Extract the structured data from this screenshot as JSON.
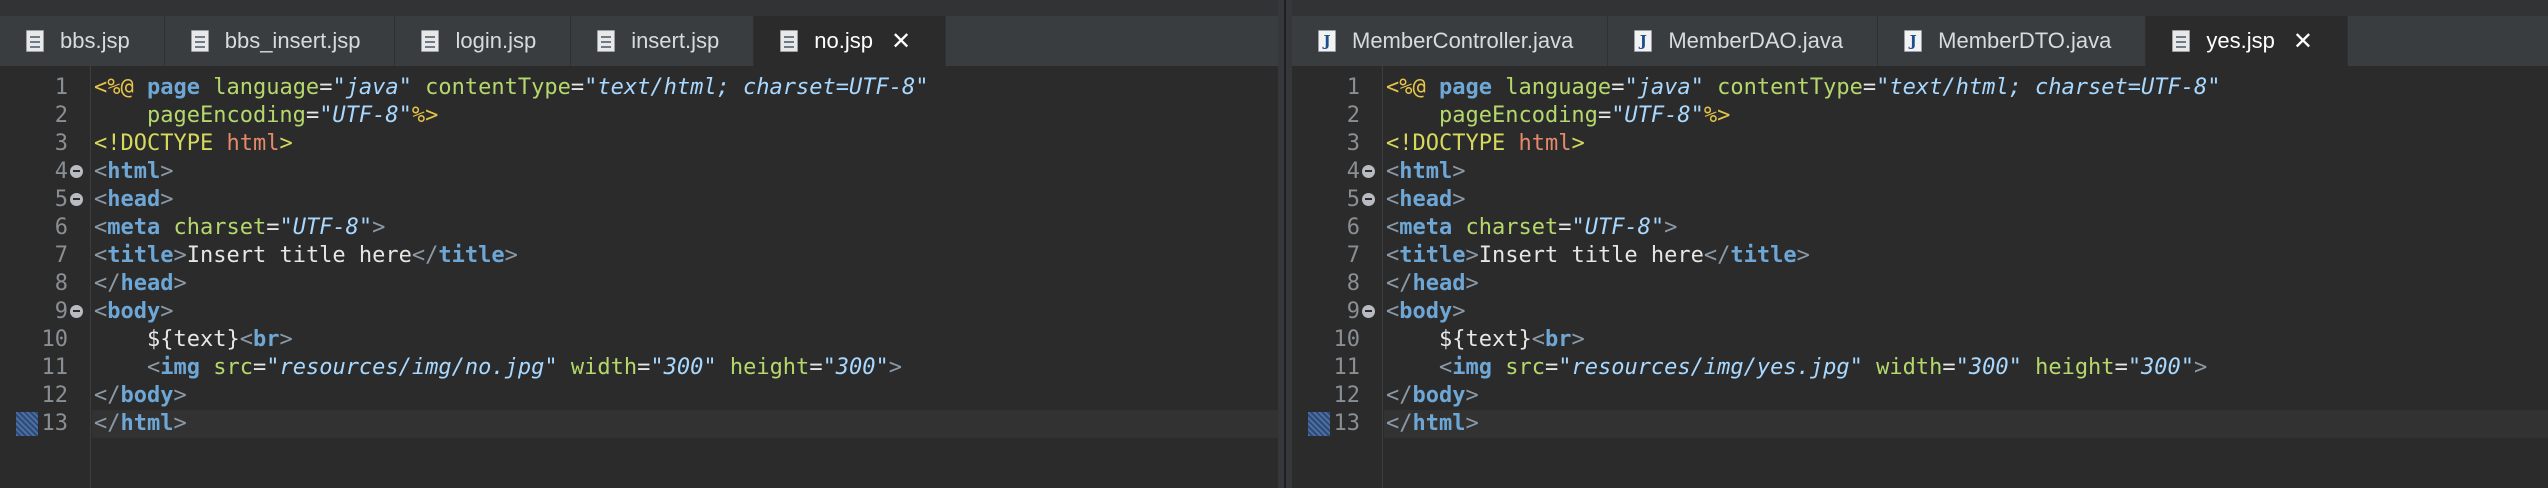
{
  "left_pane": {
    "tabs": [
      {
        "label": "bbs.jsp",
        "icon": "jsp-file-icon",
        "active": false
      },
      {
        "label": "bbs_insert.jsp",
        "icon": "jsp-file-icon",
        "active": false
      },
      {
        "label": "login.jsp",
        "icon": "jsp-file-icon",
        "active": false
      },
      {
        "label": "insert.jsp",
        "icon": "jsp-file-icon",
        "active": false
      },
      {
        "label": "no.jsp",
        "icon": "jsp-file-icon",
        "active": true,
        "close": "✕"
      }
    ],
    "lines": [
      {
        "n": "1",
        "tokens": [
          [
            "dir",
            "<%@ "
          ],
          [
            "kw",
            "page "
          ],
          [
            "attr",
            "language"
          ],
          [
            "text",
            "="
          ],
          [
            "str",
            "\"java\" "
          ],
          [
            "attr",
            "contentType"
          ],
          [
            "text",
            "="
          ],
          [
            "str",
            "\"text/html; charset=UTF-8\""
          ]
        ]
      },
      {
        "n": "2",
        "tokens": [
          [
            "text",
            "    "
          ],
          [
            "attr",
            "pageEncoding"
          ],
          [
            "text",
            "="
          ],
          [
            "str",
            "\"UTF-8\""
          ],
          [
            "dir",
            "%>"
          ]
        ]
      },
      {
        "n": "3",
        "tokens": [
          [
            "doc",
            "<!DOCTYPE "
          ],
          [
            "html",
            "html"
          ],
          [
            "doc",
            ">"
          ]
        ]
      },
      {
        "n": "4",
        "fold": true,
        "tokens": [
          [
            "br",
            "<"
          ],
          [
            "kw",
            "html"
          ],
          [
            "br",
            ">"
          ]
        ]
      },
      {
        "n": "5",
        "fold": true,
        "tokens": [
          [
            "br",
            "<"
          ],
          [
            "kw",
            "head"
          ],
          [
            "br",
            ">"
          ]
        ]
      },
      {
        "n": "6",
        "tokens": [
          [
            "br",
            "<"
          ],
          [
            "kw",
            "meta "
          ],
          [
            "attr",
            "charset"
          ],
          [
            "text",
            "="
          ],
          [
            "str",
            "\"UTF-8\""
          ],
          [
            "br",
            ">"
          ]
        ]
      },
      {
        "n": "7",
        "tokens": [
          [
            "br",
            "<"
          ],
          [
            "kw",
            "title"
          ],
          [
            "br",
            ">"
          ],
          [
            "text",
            "Insert title here"
          ],
          [
            "br",
            "</"
          ],
          [
            "kw",
            "title"
          ],
          [
            "br",
            ">"
          ]
        ]
      },
      {
        "n": "8",
        "tokens": [
          [
            "br",
            "</"
          ],
          [
            "kw",
            "head"
          ],
          [
            "br",
            ">"
          ]
        ]
      },
      {
        "n": "9",
        "fold": true,
        "tokens": [
          [
            "br",
            "<"
          ],
          [
            "kw",
            "body"
          ],
          [
            "br",
            ">"
          ]
        ]
      },
      {
        "n": "10",
        "tokens": [
          [
            "text",
            "    ${text}"
          ],
          [
            "br",
            "<"
          ],
          [
            "kw",
            "br"
          ],
          [
            "br",
            ">"
          ]
        ]
      },
      {
        "n": "11",
        "tokens": [
          [
            "text",
            "    "
          ],
          [
            "br",
            "<"
          ],
          [
            "kw",
            "img "
          ],
          [
            "attr",
            "src"
          ],
          [
            "text",
            "="
          ],
          [
            "str",
            "\"resources/img/no.jpg\" "
          ],
          [
            "attr",
            "width"
          ],
          [
            "text",
            "="
          ],
          [
            "str",
            "\"300\" "
          ],
          [
            "attr",
            "height"
          ],
          [
            "text",
            "="
          ],
          [
            "str",
            "\"300\""
          ],
          [
            "br",
            ">"
          ]
        ]
      },
      {
        "n": "12",
        "tokens": [
          [
            "br",
            "</"
          ],
          [
            "kw",
            "body"
          ],
          [
            "br",
            ">"
          ]
        ]
      },
      {
        "n": "13",
        "current": true,
        "marker": true,
        "tokens": [
          [
            "br",
            "</"
          ],
          [
            "kw",
            "html"
          ],
          [
            "br",
            ">"
          ]
        ]
      }
    ]
  },
  "right_pane": {
    "tabs": [
      {
        "label": "MemberController.java",
        "icon": "java-file-icon",
        "active": false
      },
      {
        "label": "MemberDAO.java",
        "icon": "java-file-icon",
        "active": false
      },
      {
        "label": "MemberDTO.java",
        "icon": "java-file-icon",
        "active": false
      },
      {
        "label": "yes.jsp",
        "icon": "jsp-file-icon",
        "active": true,
        "close": "✕"
      }
    ],
    "lines": [
      {
        "n": "1",
        "tokens": [
          [
            "dir",
            "<%@ "
          ],
          [
            "kw",
            "page "
          ],
          [
            "attr",
            "language"
          ],
          [
            "text",
            "="
          ],
          [
            "str",
            "\"java\" "
          ],
          [
            "attr",
            "contentType"
          ],
          [
            "text",
            "="
          ],
          [
            "str",
            "\"text/html; charset=UTF-8\""
          ]
        ]
      },
      {
        "n": "2",
        "tokens": [
          [
            "text",
            "    "
          ],
          [
            "attr",
            "pageEncoding"
          ],
          [
            "text",
            "="
          ],
          [
            "str",
            "\"UTF-8\""
          ],
          [
            "dir",
            "%>"
          ]
        ]
      },
      {
        "n": "3",
        "tokens": [
          [
            "doc",
            "<!DOCTYPE "
          ],
          [
            "html",
            "html"
          ],
          [
            "doc",
            ">"
          ]
        ]
      },
      {
        "n": "4",
        "fold": true,
        "tokens": [
          [
            "br",
            "<"
          ],
          [
            "kw",
            "html"
          ],
          [
            "br",
            ">"
          ]
        ]
      },
      {
        "n": "5",
        "fold": true,
        "tokens": [
          [
            "br",
            "<"
          ],
          [
            "kw",
            "head"
          ],
          [
            "br",
            ">"
          ]
        ]
      },
      {
        "n": "6",
        "tokens": [
          [
            "br",
            "<"
          ],
          [
            "kw",
            "meta "
          ],
          [
            "attr",
            "charset"
          ],
          [
            "text",
            "="
          ],
          [
            "str",
            "\"UTF-8\""
          ],
          [
            "br",
            ">"
          ]
        ]
      },
      {
        "n": "7",
        "tokens": [
          [
            "br",
            "<"
          ],
          [
            "kw",
            "title"
          ],
          [
            "br",
            ">"
          ],
          [
            "text",
            "Insert title here"
          ],
          [
            "br",
            "</"
          ],
          [
            "kw",
            "title"
          ],
          [
            "br",
            ">"
          ]
        ]
      },
      {
        "n": "8",
        "tokens": [
          [
            "br",
            "</"
          ],
          [
            "kw",
            "head"
          ],
          [
            "br",
            ">"
          ]
        ]
      },
      {
        "n": "9",
        "fold": true,
        "tokens": [
          [
            "br",
            "<"
          ],
          [
            "kw",
            "body"
          ],
          [
            "br",
            ">"
          ]
        ]
      },
      {
        "n": "10",
        "tokens": [
          [
            "text",
            "    ${text}"
          ],
          [
            "br",
            "<"
          ],
          [
            "kw",
            "br"
          ],
          [
            "br",
            ">"
          ]
        ]
      },
      {
        "n": "11",
        "tokens": [
          [
            "text",
            "    "
          ],
          [
            "br",
            "<"
          ],
          [
            "kw",
            "img "
          ],
          [
            "attr",
            "src"
          ],
          [
            "text",
            "="
          ],
          [
            "str",
            "\"resources/img/yes.jpg\" "
          ],
          [
            "attr",
            "width"
          ],
          [
            "text",
            "="
          ],
          [
            "str",
            "\"300\" "
          ],
          [
            "attr",
            "height"
          ],
          [
            "text",
            "="
          ],
          [
            "str",
            "\"300\""
          ],
          [
            "br",
            ">"
          ]
        ]
      },
      {
        "n": "12",
        "tokens": [
          [
            "br",
            "</"
          ],
          [
            "kw",
            "body"
          ],
          [
            "br",
            ">"
          ]
        ]
      },
      {
        "n": "13",
        "current": true,
        "marker": true,
        "tokens": [
          [
            "br",
            "</"
          ],
          [
            "kw",
            "html"
          ],
          [
            "br",
            ">"
          ]
        ]
      }
    ]
  }
}
